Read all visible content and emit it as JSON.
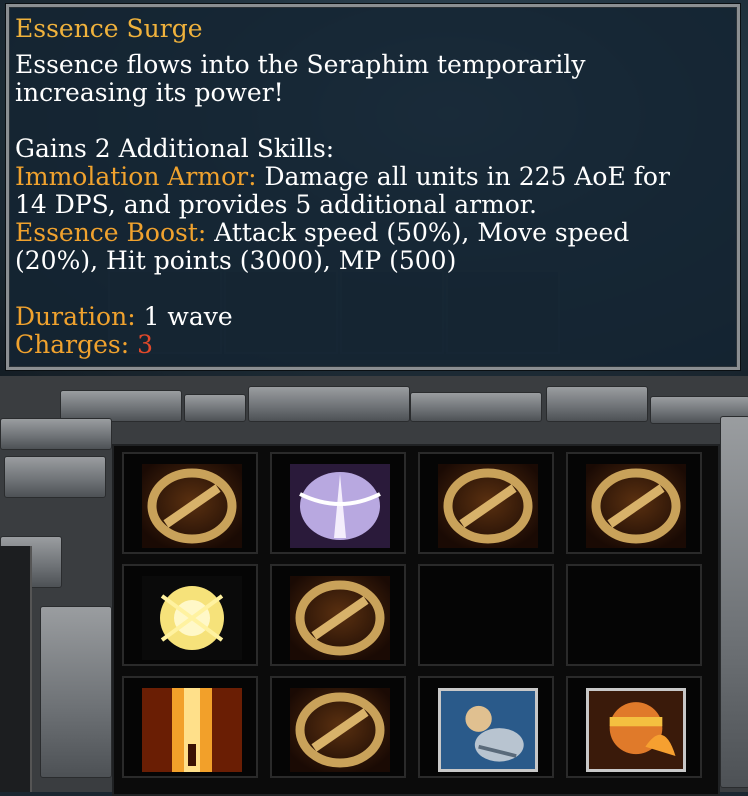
{
  "tooltip": {
    "title": "Essence Surge",
    "description_line1": "Essence flows into the Seraphim temporarily",
    "description_line2": "increasing its power!",
    "gains_line": "Gains 2 Additional Skills:",
    "skill1_name": "Immolation Armor:",
    "skill1_desc_line1": " Damage all units in 225 AoE for",
    "skill1_desc_line2": "14 DPS, and provides 5 additional armor.",
    "skill2_name": "Essence Boost:",
    "skill2_desc_line1": " Attack speed (50%), Move speed",
    "skill2_desc_line2": "(20%), Hit points (3000), MP (500)",
    "duration_label": "Duration:",
    "duration_value": " 1 wave",
    "charges_label": "Charges:",
    "charges_value": " 3"
  },
  "command_grid": {
    "slots": [
      {
        "icon": "disabled-slot-icon"
      },
      {
        "icon": "seraphim-wings-icon"
      },
      {
        "icon": "disabled-slot-icon"
      },
      {
        "icon": "disabled-slot-icon"
      },
      {
        "icon": "golden-burst-icon"
      },
      {
        "icon": "disabled-slot-icon"
      },
      {
        "icon": "empty"
      },
      {
        "icon": "empty"
      },
      {
        "icon": "fire-pillar-icon"
      },
      {
        "icon": "disabled-slot-icon"
      },
      {
        "icon": "armored-fist-icon"
      },
      {
        "icon": "immolation-hero-icon"
      }
    ]
  },
  "colors": {
    "title": "#f0b23c",
    "highlight": "#f0a22e",
    "charges_value": "#e0492a",
    "text": "#ffffff"
  }
}
